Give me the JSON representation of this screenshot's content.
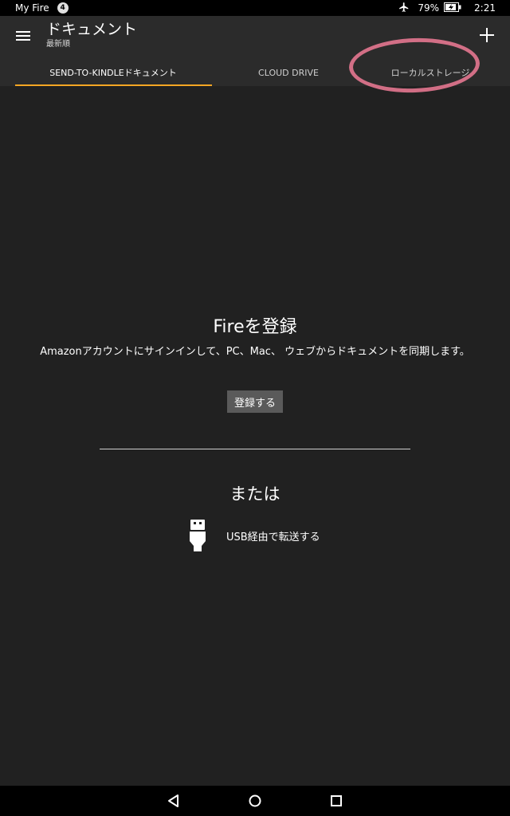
{
  "status_bar": {
    "device_name": "My Fire",
    "notification_count": "4",
    "battery": "79%",
    "time": "2:21",
    "icons": [
      "airplane-icon",
      "battery-charging-icon"
    ]
  },
  "app_bar": {
    "title": "ドキュメント",
    "subtitle": "最新順",
    "menu_icon": "hamburger-menu-icon",
    "add_icon": "plus-icon"
  },
  "tabs": [
    {
      "label": "SEND-TO-KINDLEドキュメント",
      "selected": true
    },
    {
      "label": "CLOUD DRIVE",
      "selected": false
    },
    {
      "label": "ローカルストレージ",
      "selected": false
    }
  ],
  "main": {
    "heading": "Fireを登録",
    "description": "Amazonアカウントにサインインして、PC、Mac、 ウェブからドキュメントを同期します。",
    "register_button": "登録する",
    "or_text": "または",
    "usb_label": "USB経由で転送する",
    "usb_icon": "usb-icon"
  },
  "nav_bar": {
    "icons": [
      "back-icon",
      "home-icon",
      "recents-icon"
    ]
  },
  "colors": {
    "background": "#212121",
    "app_bar": "#2b2b2b",
    "accent": "#f5a623",
    "highlight": "#f07b96"
  }
}
